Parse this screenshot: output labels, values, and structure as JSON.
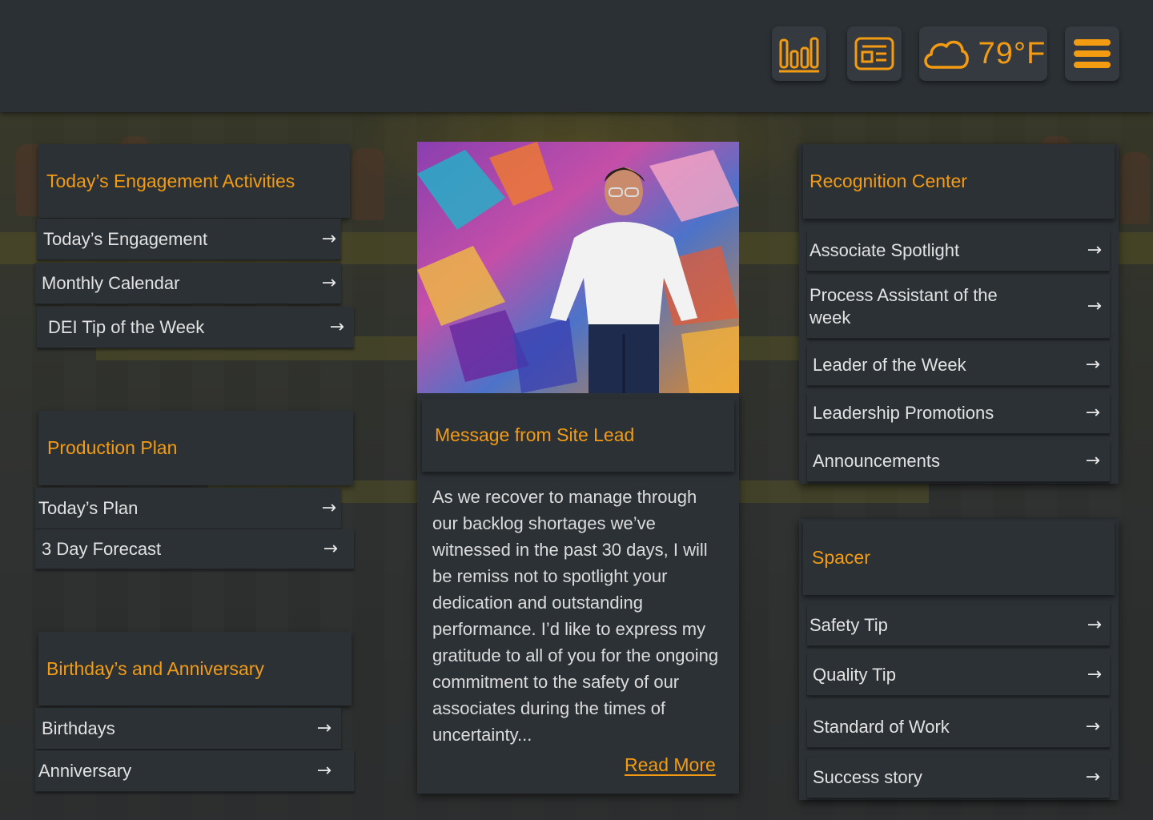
{
  "header": {
    "stats_icon": "bar-chart-icon",
    "news_icon": "newspaper-icon",
    "weather": {
      "icon": "cloud-icon",
      "temperature": "79°F"
    },
    "menu_icon": "hamburger-menu-icon"
  },
  "colors": {
    "accent": "#f39c12",
    "card": "#2c3135",
    "header": "#2b3034"
  },
  "engagement": {
    "title": "Today’s Engagement Activities",
    "items": [
      {
        "label": "Today’s Engagement",
        "icon": "arrow-right-icon"
      },
      {
        "label": "Monthly Calendar",
        "icon": "arrow-right-icon"
      },
      {
        "label": "DEI Tip of the Week",
        "icon": "arrow-right-icon"
      }
    ]
  },
  "production": {
    "title": "Production Plan",
    "items": [
      {
        "label": "Today’s Plan",
        "icon": "arrow-right-icon"
      },
      {
        "label": "3 Day Forecast",
        "icon": "arrow-right-icon"
      }
    ]
  },
  "birthdays": {
    "title": "Birthday’s and Anniversary",
    "items": [
      {
        "label": "Birthdays",
        "icon": "arrow-right-icon"
      },
      {
        "label": "Anniversary",
        "icon": "arrow-right-icon"
      }
    ]
  },
  "message": {
    "title": "Message from Site Lead",
    "body": " As we recover to manage through our backlog shortages we’ve witnessed in the past 30 days, I will be remiss not to spotlight your dedication and outstanding performance. I’d like to express my gratitude to all of you for the ongoing commitment to the safety of our associates during the times of uncertainty...",
    "read_more": "Read More"
  },
  "recognition": {
    "title": "Recognition Center",
    "items": [
      {
        "label": "Associate Spotlight",
        "icon": "arrow-right-icon"
      },
      {
        "label": "Process Assistant of the week",
        "icon": "arrow-right-icon"
      },
      {
        "label": "Leader of the Week",
        "icon": "arrow-right-icon"
      },
      {
        "label": "Leadership Promotions",
        "icon": "arrow-right-icon"
      },
      {
        "label": "Announcements",
        "icon": "arrow-right-icon"
      }
    ]
  },
  "spacer": {
    "title": "Spacer",
    "items": [
      {
        "label": "Safety Tip",
        "icon": "arrow-right-icon"
      },
      {
        "label": "Quality Tip",
        "icon": "arrow-right-icon"
      },
      {
        "label": "Standard of Work",
        "icon": "arrow-right-icon"
      },
      {
        "label": "Success story",
        "icon": "arrow-right-icon"
      }
    ]
  }
}
